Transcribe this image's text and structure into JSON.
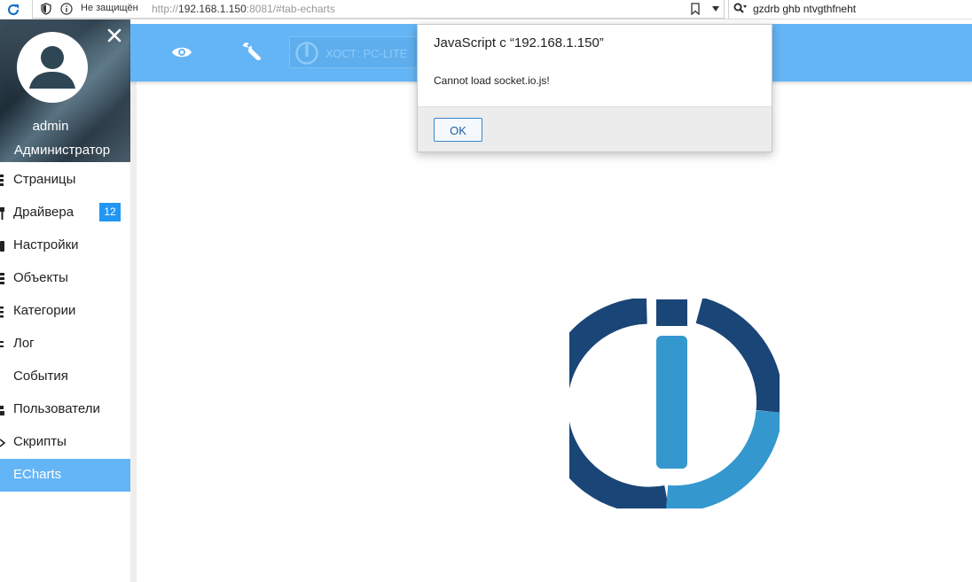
{
  "browser": {
    "security_label": "Не защищён",
    "url_prefix": "http://",
    "url_host": "192.168.1.150",
    "url_rest": ":8081/#tab-echarts",
    "search_value": "gzdrb ghb ntvgthfneht"
  },
  "profile": {
    "user_name": "admin",
    "user_role": "Администратор"
  },
  "menu": {
    "items": [
      {
        "label": "Страницы"
      },
      {
        "label": "Драйвера",
        "badge": "12"
      },
      {
        "label": "Настройки"
      },
      {
        "label": "Объекты"
      },
      {
        "label": "Категории"
      },
      {
        "label": "Лог"
      },
      {
        "label": "События"
      },
      {
        "label": "Пользователи"
      },
      {
        "label": "Скрипты"
      },
      {
        "label": "ECharts",
        "active": true
      }
    ]
  },
  "toolbar": {
    "host_label": "ХОСТ: PC-LITE"
  },
  "dialog": {
    "title": "JavaScript с “192.168.1.150”",
    "message": "Cannot load socket.io.js!",
    "ok_label": "OK"
  },
  "colors": {
    "accent": "#64b5f6",
    "badge": "#2196f3",
    "logo_dark": "#1a4577",
    "logo_light": "#3498ce"
  },
  "icons": {
    "reload": "reload-icon",
    "shield": "shield-icon",
    "info": "info-icon",
    "bookmark": "bookmark-icon",
    "search": "search-icon",
    "close": "close-icon",
    "eye": "eye-icon",
    "wrench": "wrench-icon",
    "logo": "iobroker-logo-icon"
  }
}
